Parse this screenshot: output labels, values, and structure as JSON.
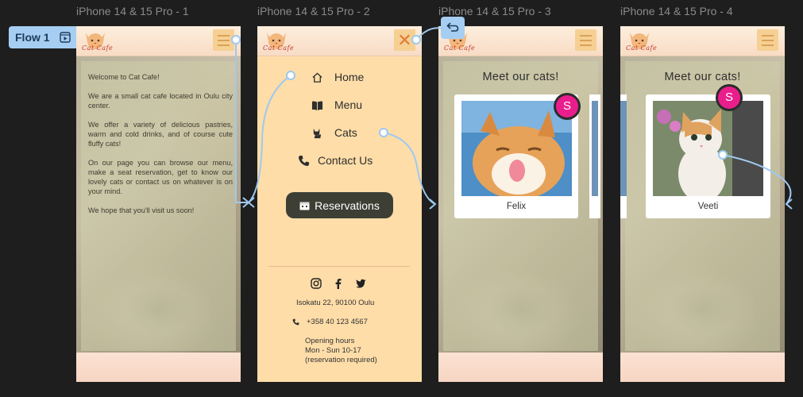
{
  "frames": [
    {
      "title": "iPhone 14 & 15 Pro - 1"
    },
    {
      "title": "iPhone 14 & 15 Pro - 2"
    },
    {
      "title": "iPhone 14 & 15 Pro - 3"
    },
    {
      "title": "iPhone 14 & 15 Pro - 4"
    }
  ],
  "flow": {
    "label": "Flow 1",
    "back_icon": "back-arrow-icon"
  },
  "logo": {
    "text": "Cat Cafe",
    "icon": "cat-face-icon"
  },
  "welcome": {
    "p1": "Welcome to Cat Cafe!",
    "p2": "We are a small cat cafe located in Oulu city center.",
    "p3": "We offer a variety of delicious pastries, warm and cold drinks, and of course cute fluffy cats!",
    "p4": "On our page you can browse our menu, make a seat reservation, get to know our lovely cats or contact us on whatever is on your mind.",
    "p5": "We hope that you'll visit us soon!"
  },
  "menu": {
    "close_glyph": "✕",
    "items": [
      {
        "label": "Home",
        "icon": "home-icon"
      },
      {
        "label": "Menu",
        "icon": "book-icon"
      },
      {
        "label": "Cats",
        "icon": "cat-icon"
      },
      {
        "label": "Contact Us",
        "icon": "phone-icon"
      }
    ],
    "reservations_label": "Reservations",
    "address": "Isokatu 22, 90100 Oulu",
    "phone": "+358 40 123 4567",
    "hours_title": "Opening hours",
    "hours_days": "Mon - Sun 10-17",
    "hours_note": "(reservation required)",
    "socials": [
      "instagram-icon",
      "facebook-icon",
      "twitter-icon"
    ]
  },
  "cats": {
    "title": "Meet our cats!",
    "cards": [
      {
        "name": "Felix"
      },
      {
        "name": "Veeti"
      }
    ]
  },
  "avatar": {
    "initial": "S",
    "color": "#e91e8c"
  },
  "colors": {
    "canvas": "#1e1e1e",
    "menu_bg": "#fedda8",
    "button_dark": "#3d3f35",
    "flow_blue": "#a6cef2",
    "accent_orange": "#f6cf93"
  }
}
